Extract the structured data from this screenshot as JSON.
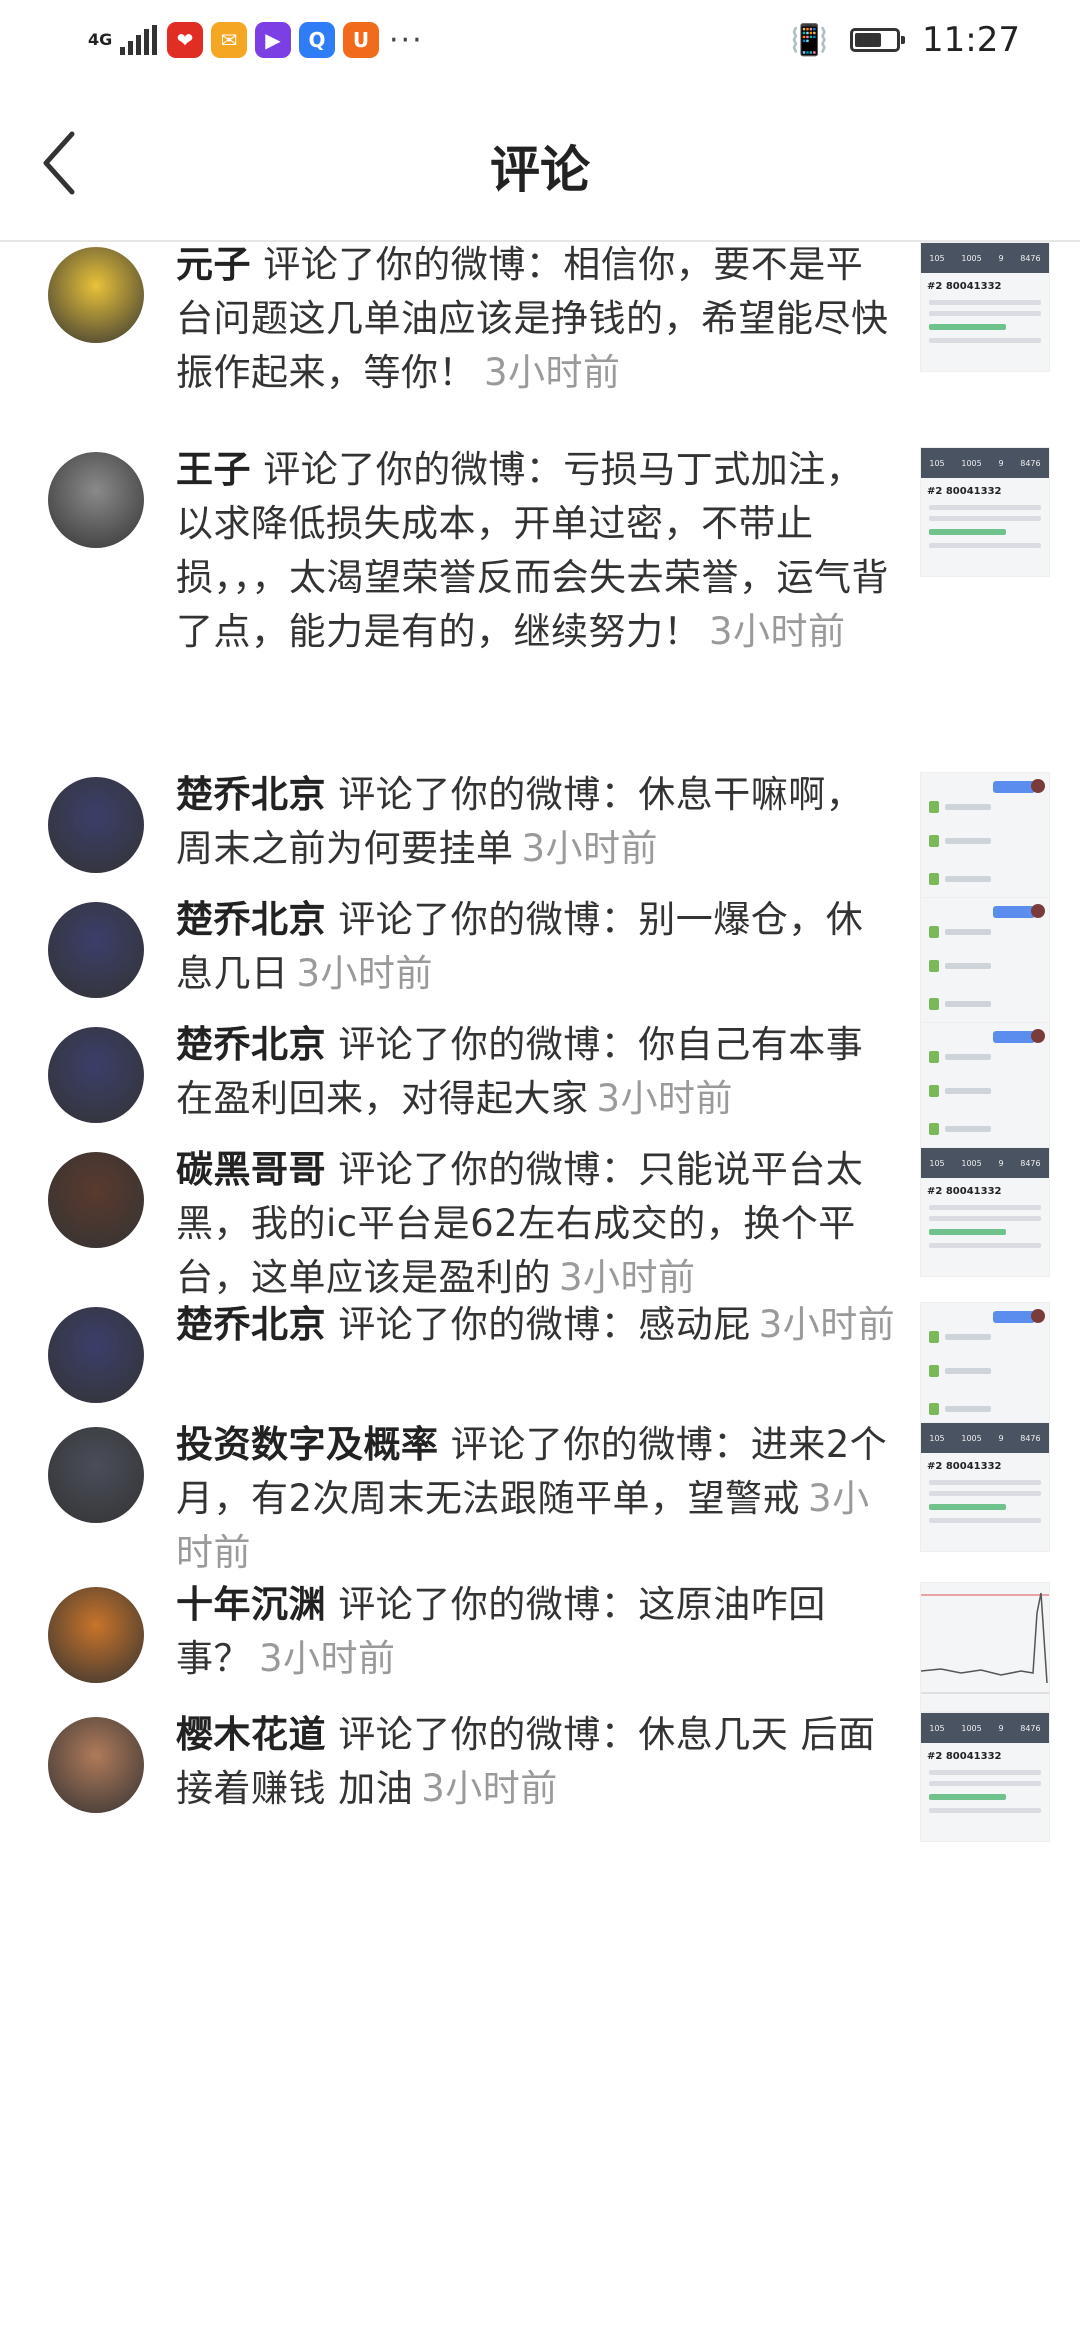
{
  "status_bar": {
    "network": "4G",
    "time": "11:27",
    "battery_level": 0.65,
    "app_icons": [
      {
        "name": "pinduoduo-icon",
        "color": "#e02e24",
        "glyph": "❤"
      },
      {
        "name": "mail-icon",
        "color": "#f5a623",
        "glyph": "✉"
      },
      {
        "name": "video-player-icon",
        "color": "#7b3fe4",
        "glyph": "▶"
      },
      {
        "name": "browser-icon",
        "color": "#2f7df6",
        "glyph": "Q"
      },
      {
        "name": "uc-browser-icon",
        "color": "#f26b1d",
        "glyph": "U"
      }
    ],
    "more_icon": "···"
  },
  "header": {
    "title": "评论",
    "back_icon": "chevron-left-icon"
  },
  "comments": [
    {
      "user": "元子",
      "text": "评论了你的微博：相信你，要不是平台问题这几单油应该是挣钱的，希望能尽快振作起来，等你！",
      "time": "3小时前",
      "avatar_color": "#e8c23a",
      "thumb": "trade"
    },
    {
      "user": "王子",
      "text": "评论了你的微博：亏损马丁式加注，以求降低损失成本，开单过密，不带止损，，，太渴望荣誉反而会失去荣誉，运气背了点，能力是有的，继续努力！",
      "time": "3小时前",
      "avatar_color": "#8a8a8a",
      "thumb": "trade"
    },
    {
      "user": "楚乔北京",
      "text": "评论了你的微博：休息干嘛啊，周末之前为何要挂单",
      "time": "3小时前",
      "avatar_color": "#3b3f6a",
      "thumb": "chat"
    },
    {
      "user": "楚乔北京",
      "text": "评论了你的微博：别一爆仓，休息几日",
      "time": "3小时前",
      "avatar_color": "#3b3f6a",
      "thumb": "chat"
    },
    {
      "user": "楚乔北京",
      "text": "评论了你的微博：你自己有本事在盈利回来，对得起大家",
      "time": "3小时前",
      "avatar_color": "#3b3f6a",
      "thumb": "chat"
    },
    {
      "user": "碳黑哥哥",
      "text": "评论了你的微博：只能说平台太黑，我的ic平台是62左右成交的，换个平台，这单应该是盈利的",
      "time": "3小时前",
      "avatar_color": "#5a3a2e",
      "thumb": "trade"
    },
    {
      "user": "楚乔北京",
      "text": "评论了你的微博：感动屁",
      "time": "3小时前",
      "avatar_color": "#3b3f6a",
      "thumb": "chat"
    },
    {
      "user": "投资数字及概率",
      "text": "评论了你的微博：进来2个月，有2次周末无法跟随平单，望警戒",
      "time": "3小时前",
      "avatar_color": "#4a4e5a",
      "thumb": "trade"
    },
    {
      "user": "十年沉渊",
      "text": "评论了你的微博：这原油咋回事？",
      "time": "3小时前",
      "avatar_color": "#c9742a",
      "thumb": "plot"
    },
    {
      "user": "樱木花道",
      "text": "评论了你的微博：休息几天 后面接着赚钱 加油",
      "time": "3小时前",
      "avatar_color": "#b07a5a",
      "thumb": "trade"
    }
  ],
  "thumb_text": {
    "trade_stats": [
      "105",
      "1005",
      "9",
      "8476"
    ],
    "trade_account": "#2 80041332"
  }
}
